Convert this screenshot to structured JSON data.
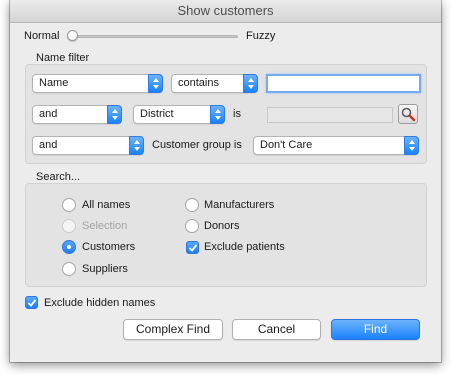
{
  "window": {
    "title": "Show customers"
  },
  "slider": {
    "left_label": "Normal",
    "right_label": "Fuzzy",
    "position": 0
  },
  "name_filter": {
    "legend": "Name filter",
    "row1": {
      "field": "Name",
      "operator": "contains",
      "value": ""
    },
    "row2": {
      "conjunction": "and",
      "field": "District",
      "operator_text": "is",
      "value": ""
    },
    "row3": {
      "conjunction": "and",
      "field_text": "Customer group is",
      "value": "Don't Care"
    }
  },
  "search": {
    "legend": "Search...",
    "options": {
      "all_names": "All names",
      "selection": "Selection",
      "customers": "Customers",
      "suppliers": "Suppliers",
      "manufacturers": "Manufacturers",
      "donors": "Donors",
      "exclude_patients": "Exclude patients"
    },
    "selected": "customers",
    "exclude_patients_checked": true
  },
  "exclude_hidden": {
    "label": "Exclude hidden names",
    "checked": true
  },
  "buttons": {
    "complex_find": "Complex Find",
    "cancel": "Cancel",
    "find": "Find"
  },
  "icons": {
    "lookup": "magnifier-icon",
    "popup_arrow": "updown-chevron-icon"
  },
  "colors": {
    "accent": "#1a82fb",
    "focus": "#75a9f0"
  }
}
